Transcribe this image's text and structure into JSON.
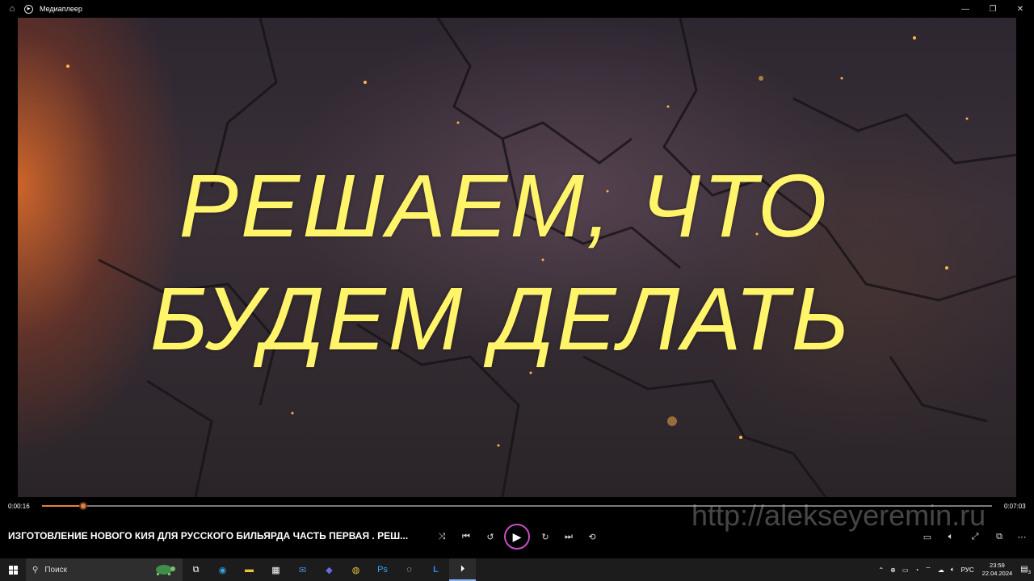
{
  "window": {
    "title": "Медиаплеер",
    "home_icon": "home-icon",
    "app_icon": "media-player-icon",
    "controls": [
      "minimize-icon",
      "restore-icon",
      "close-icon"
    ]
  },
  "video": {
    "line1": "РЕШАЕМ, ЧТО",
    "line2": "БУДЕМ ДЕЛАТЬ",
    "text_color": "#fff46a"
  },
  "player": {
    "current_time": "0:00:16",
    "total_time": "0:07:03",
    "progress": 0.043,
    "accent_color": "#e8813a",
    "watermark": "http://alekseyeremin.ru",
    "now_playing": "ИЗГОТОВЛЕНИЕ НОВОГО КИЯ ДЛЯ РУССКОГО БИЛЬЯРДА ЧАСТЬ ПЕРВАЯ . РЕШ..."
  },
  "taskbar": {
    "search_placeholder": "Поиск",
    "language": "РУС",
    "time": "23:59",
    "date": "22.04.2024",
    "notifications": "3"
  }
}
